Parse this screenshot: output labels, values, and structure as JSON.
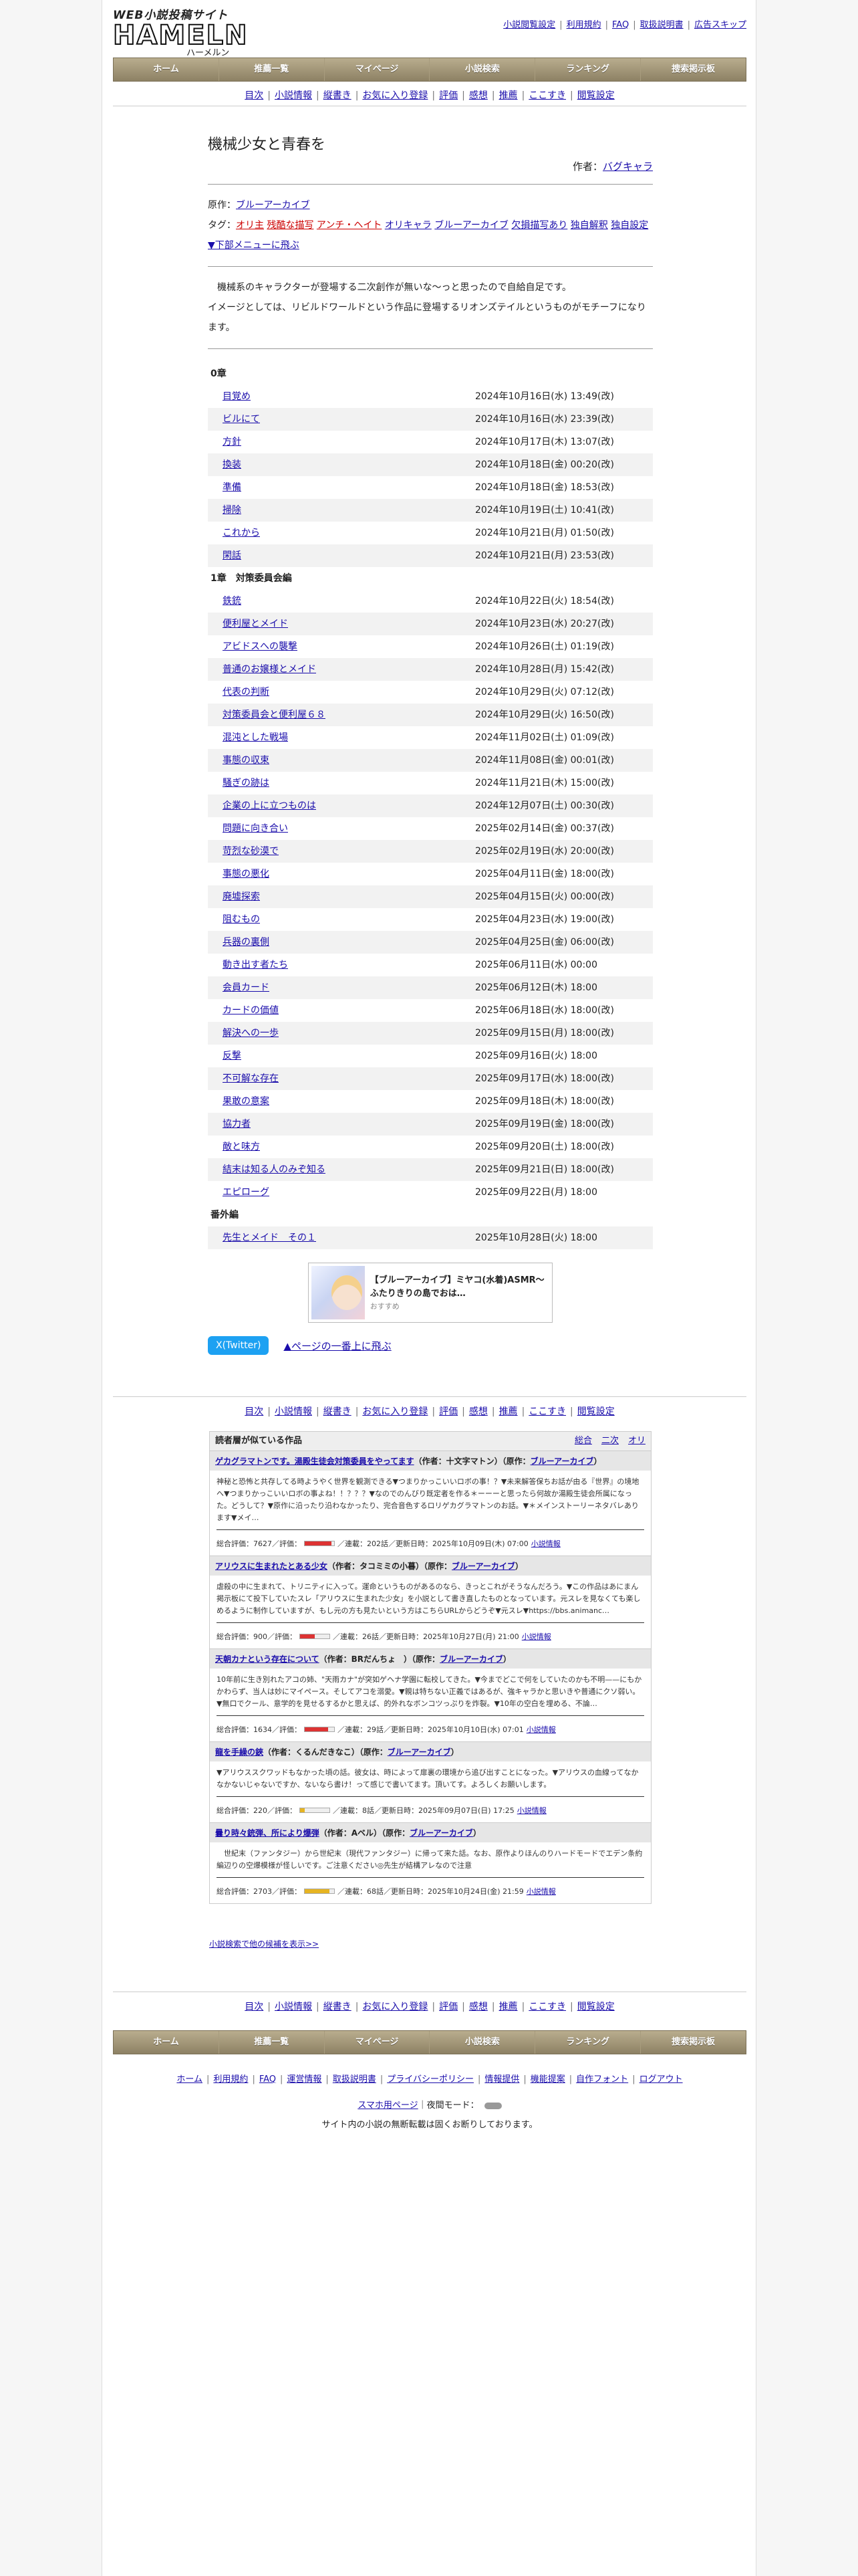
{
  "site": {
    "tagline": "WEB小説投稿サイト",
    "name": "HAMELN",
    "kana": "ハーメルン"
  },
  "toplinks": [
    "小説閲覧設定",
    "利用規約",
    "FAQ",
    "取扱説明書",
    "広告スキップ"
  ],
  "nav": [
    "ホーム",
    "推薦一覧",
    "マイページ",
    "小説検索",
    "ランキング",
    "捜索掲示板"
  ],
  "subnav": [
    "目次",
    "小説情報",
    "縦書き",
    "お気に入り登録",
    "評価",
    "感想",
    "推薦",
    "ここすき",
    "閲覧設定"
  ],
  "novel": {
    "title": "機械少女と青春を",
    "author_label": "作者：",
    "author": "バグキャラ",
    "source_label": "原作：",
    "source": "ブルーアーカイブ",
    "tags_label": "タグ：",
    "tags_red": [
      "オリ主",
      "残酷な描写",
      "アンチ・ヘイト"
    ],
    "tags": [
      "オリキャラ",
      "ブルーアーカイブ",
      "欠損描写あり",
      "独自解釈",
      "独自設定"
    ],
    "jump": "▼下部メニューに飛ぶ",
    "synopsis": [
      "　機械系のキャラクターが登場する二次創作が無いな〜っと思ったので自給自足です。",
      "イメージとしては、リビルドワールドという作品に登場するリオンズテイルというものがモチーフになります。"
    ]
  },
  "toc": [
    {
      "chapter": "0章",
      "eps": [
        [
          "目覚め",
          "2024年10月16日(水) 13:49(改)"
        ],
        [
          "ビルにて",
          "2024年10月16日(水) 23:39(改)"
        ],
        [
          "方針",
          "2024年10月17日(木) 13:07(改)"
        ],
        [
          "換装",
          "2024年10月18日(金) 00:20(改)"
        ],
        [
          "準備",
          "2024年10月18日(金) 18:53(改)"
        ],
        [
          "掃除",
          "2024年10月19日(土) 10:41(改)"
        ],
        [
          "これから",
          "2024年10月21日(月) 01:50(改)"
        ],
        [
          "閑話",
          "2024年10月21日(月) 23:53(改)"
        ]
      ]
    },
    {
      "chapter": "1章　対策委員会編",
      "eps": [
        [
          "鉄銃",
          "2024年10月22日(火) 18:54(改)"
        ],
        [
          "便利屋とメイド",
          "2024年10月23日(水) 20:27(改)"
        ],
        [
          "アビドスへの襲撃",
          "2024年10月26日(土) 01:19(改)"
        ],
        [
          "普通のお嬢様とメイド",
          "2024年10月28日(月) 15:42(改)"
        ],
        [
          "代表の判断",
          "2024年10月29日(火) 07:12(改)"
        ],
        [
          "対策委員会と便利屋６８",
          "2024年10月29日(火) 16:50(改)"
        ],
        [
          "混沌とした戦場",
          "2024年11月02日(土) 01:09(改)"
        ],
        [
          "事態の収束",
          "2024年11月08日(金) 00:01(改)"
        ],
        [
          "騒ぎの跡は",
          "2024年11月21日(木) 15:00(改)"
        ],
        [
          "企業の上に立つものは",
          "2024年12月07日(土) 00:30(改)"
        ],
        [
          "問題に向き合い",
          "2025年02月14日(金) 00:37(改)"
        ],
        [
          "苛烈な砂漠で",
          "2025年02月19日(水) 20:00(改)"
        ],
        [
          "事態の悪化",
          "2025年04月11日(金) 18:00(改)"
        ],
        [
          "廃墟探索",
          "2025年04月15日(火) 00:00(改)"
        ],
        [
          "阻むもの",
          "2025年04月23日(水) 19:00(改)"
        ],
        [
          "兵器の裏側",
          "2025年04月25日(金) 06:00(改)"
        ],
        [
          "動き出す者たち",
          "2025年06月11日(水) 00:00"
        ],
        [
          "会員カード",
          "2025年06月12日(木) 18:00"
        ],
        [
          "カードの価値",
          "2025年06月18日(水) 18:00(改)"
        ],
        [
          "解決への一歩",
          "2025年09月15日(月) 18:00(改)"
        ],
        [
          "反撃",
          "2025年09月16日(火) 18:00"
        ],
        [
          "不可解な存在",
          "2025年09月17日(水) 18:00(改)"
        ],
        [
          "果敢の意案",
          "2025年09月18日(木) 18:00(改)"
        ],
        [
          "協力者",
          "2025年09月19日(金) 18:00(改)"
        ],
        [
          "敵と味方",
          "2025年09月20日(土) 18:00(改)"
        ],
        [
          "結末は知る人のみぞ知る",
          "2025年09月21日(日) 18:00(改)"
        ],
        [
          "エピローグ",
          "2025年09月22日(月) 18:00"
        ]
      ]
    },
    {
      "chapter": "番外編",
      "eps": [
        [
          "先生とメイド　その１",
          "2025年10月28日(火) 18:00"
        ]
      ]
    }
  ],
  "ad": {
    "title": "【ブルーアーカイブ】ミヤコ(水着)ASMR〜ふたりきりの島でおは…",
    "source": "おすすめ"
  },
  "share": "X(Twitter)",
  "pagetop": "▲ページの一番上に飛ぶ",
  "rec": {
    "header": "読者層が似ている作品",
    "tabs": [
      "総合",
      "二次",
      "オリ"
    ],
    "items": [
      {
        "title": "ゲカグラマトンです。湯殿生徒会対策委員をやってます",
        "author": "（作者：十文字マトン）",
        "orig": "ブルーアーカイブ",
        "body": "神秘と恐怖と共存してる時ようやく世界を観測できる▼つまりかっこいいロボの事！？▼未来解答保ちお話が由る『世界』の境地へ▼つまりかっこいいロボの事よね！！？？？▼なのでのんびり既定者を作る＊ーーーと思ったら何故か湯殿生徒会所属になった。どうして？▼原作に沿ったり沿わなかったり、完合音色するロリゲカグラマトンのお話。▼＊メインストーリーネタバレあります▼メイ…",
        "score": "総合評価：7627／評価：",
        "bar": 0.9,
        "barcolor": "#d33",
        "rest": "／連載：202話／更新日時：2025年10月09日(木) 07:00",
        "info": "小説情報"
      },
      {
        "title": "アリウスに生まれたとある少女",
        "author": "（作者：タコミミの小暮）",
        "orig": "ブルーアーカイブ",
        "body": "虐殺の中に生まれて、トリニティに入って。運命というものがあるのなら、きっとこれがそうなんだろう。▼この作品はあにまん掲示板にて投下していたスレ「アリウスに生まれた少女」を小説として書き直したものとなっています。元スレを見なくても楽しめるように制作していますが、もし元の方も見たいという方はこちらURLからどうぞ▼元スレ▼https://bbs.animanc…",
        "score": "総合評価：900／評価：",
        "bar": 0.5,
        "barcolor": "#d33",
        "rest": "／連載：26話／更新日時：2025年10月27日(月) 21:00",
        "info": "小説情報"
      },
      {
        "title": "天朝カナという存在について",
        "author": "（作者：BRだんちょ　）",
        "orig": "ブルーアーカイブ",
        "body": "10年前に生き別れたアコの姉、\"天雨カナ\"が突如ゲヘナ学園に転校してきた。▼今までどこで何をしていたのかも不明——にもかかわらず、当人は妙にマイペース。そしてアコを溺愛。▼親は特ちない正義ではあるが、強キャラかと思いきや普通にクソ弱い。▼無口でクール、意学的を見せるするかと思えば、的外れなボンコツっぷりを炸裂。▼10年の空白を埋める、不論…",
        "score": "総合評価：1634／評価：",
        "bar": 0.8,
        "barcolor": "#d33",
        "rest": "／連載：29話／更新日時：2025年10月10日(水) 07:01",
        "info": "小説情報"
      },
      {
        "title": "龍を手繰の鋏",
        "author": "（作者：くるんだきなこ）",
        "orig": "ブルーアーカイブ",
        "body": "▼アリウススクワッドもなかった頃の話。彼女は、時によって扉裏の環境から追び出すことになった。▼アリウスの血線ってなかなかないじゃないですか、ないなら書け！って感じで書いてます。頂いてす。よろしくお願いします。",
        "score": "総合評価：220／評価：",
        "bar": 0.15,
        "barcolor": "#e6b422",
        "rest": "／連載：8話／更新日時：2025年09月07日(日) 17:25",
        "info": "小説情報"
      },
      {
        "title": "曇り時々銃弾、所により爆弾",
        "author": "（作者：Aベル）",
        "orig": "ブルーアーカイブ",
        "body": "　世紀末（ファンタジー）から世紀末（現代ファンタジー）に帰って来た話。なお、原作よりほんのりハードモードでエデン条約編辺りの空爆模様が怪しいです。ご注意ください◎先生が結構アレなので注意",
        "score": "総合評価：2703／評価：",
        "bar": 0.85,
        "barcolor": "#e6b422",
        "rest": "／連載：68話／更新日時：2025年10月24日(金) 21:59",
        "info": "小説情報"
      }
    ],
    "more": "小説検索で他の候補を表示>>"
  },
  "footer": {
    "links": [
      "ホーム",
      "利用規約",
      "FAQ",
      "運営情報",
      "取扱説明書",
      "プライバシーポリシー",
      "情報提供",
      "機能提案",
      "自作フォント",
      "ログアウト"
    ],
    "mobile": "スマホ用ページ",
    "dark_label": "｜夜間モード：",
    "notice": "サイト内の小説の無断転載は固くお断りしております。"
  }
}
